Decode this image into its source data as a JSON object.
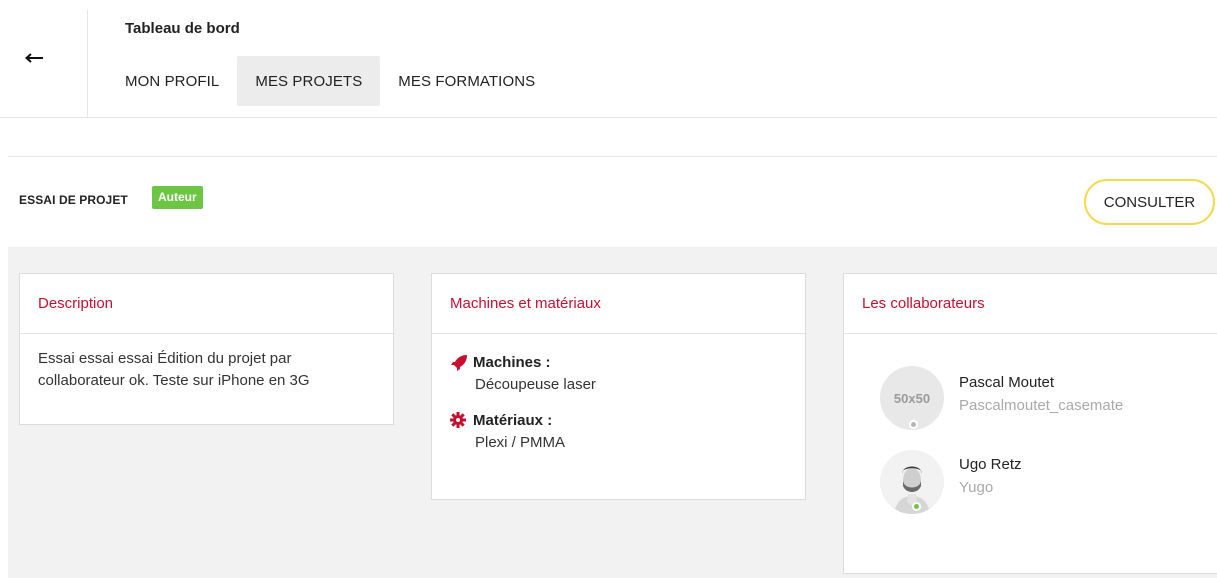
{
  "header": {
    "title": "Tableau de bord",
    "back_icon": "arrow-left-icon",
    "tabs": [
      {
        "label": "MON PROFIL",
        "active": false
      },
      {
        "label": "MES PROJETS",
        "active": true
      },
      {
        "label": "MES FORMATIONS",
        "active": false
      }
    ]
  },
  "project": {
    "title": "ESSAI DE PROJET",
    "badge": "Auteur",
    "badge_color": "#6cc644",
    "consult_label": "CONSULTER",
    "consult_border_color": "#f5d94a"
  },
  "cards": {
    "description": {
      "title": "Description",
      "text": "Essai essai essai Édition du projet par collaborateur ok. Teste sur iPhone en 3G"
    },
    "machines": {
      "title": "Machines et matériaux",
      "machines_label": "Machines :",
      "machines_value": "Découpeuse laser",
      "machines_icon": "rocket-icon",
      "materials_label": "Matériaux :",
      "materials_value": "Plexi / PMMA",
      "materials_icon": "gear-icon"
    },
    "collaborators": {
      "title": "Les collaborateurs",
      "items": [
        {
          "name": "Pascal Moutet",
          "username": "Pascalmoutet_casemate",
          "avatar_text": "50x50",
          "status": "offline",
          "status_color": "#b5b5b5"
        },
        {
          "name": "Ugo Retz",
          "username": "Yugo",
          "avatar_text": "",
          "status": "online",
          "status_color": "#6cc644"
        }
      ]
    }
  },
  "colors": {
    "accent_red": "#c8102e",
    "background_gray": "#f2f2f2"
  }
}
